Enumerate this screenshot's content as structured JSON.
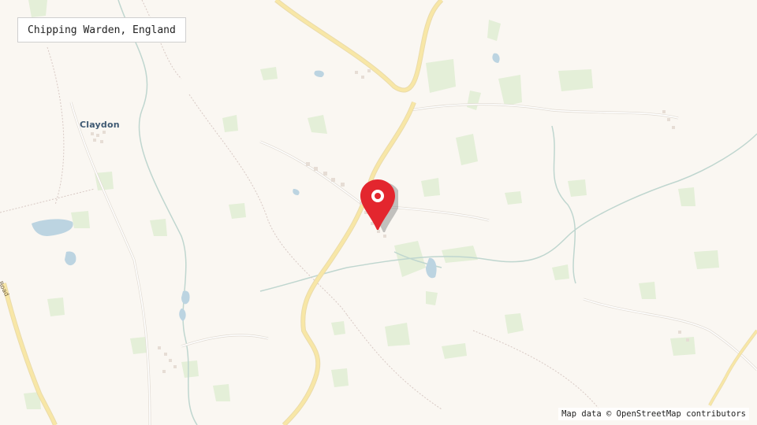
{
  "map": {
    "title": "Chipping Warden, England",
    "attribution": "Map data © OpenStreetMap contributors",
    "labels": {
      "claydon": "Claydon",
      "road": "Road"
    },
    "colors": {
      "land": "#faf7f2",
      "woodland": "#e3efd6",
      "water": "#b9d3e0",
      "major_road": "#f8e7a6",
      "minor_road": "#ffffff",
      "marker": "#e3262e"
    },
    "icons": {
      "marker": "map-pin-icon"
    }
  }
}
